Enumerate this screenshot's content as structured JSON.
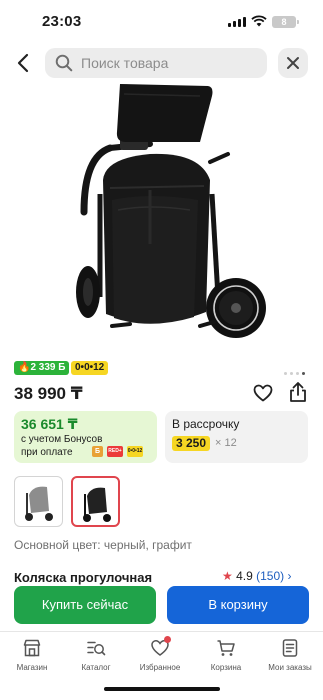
{
  "status_bar": {
    "time": "23:03",
    "battery": "8"
  },
  "search": {
    "placeholder": "Поиск товара"
  },
  "product": {
    "gallery": {
      "current_image": 4,
      "image_count": 4
    },
    "badges": {
      "bonus": "🔥2 339 Б",
      "installment": "0•0•12"
    },
    "price": "38 990 ₸",
    "bonus_card": {
      "price": "36 651 ₸",
      "line1": "с учетом Бонусов",
      "line2": "при оплате",
      "chips": [
        "Б",
        "RED+",
        "0•0•12"
      ]
    },
    "installment_card": {
      "title": "В рассрочку",
      "amount": "3 250",
      "multiplier": "× 12"
    },
    "color": "Основной цвет: черный, графит",
    "name": "Коляска прогулочная",
    "rating": {
      "value": "4.9",
      "reviews": "(150)"
    }
  },
  "actions": {
    "buy_now": "Купить сейчас",
    "add_to_cart": "В корзину"
  },
  "nav": {
    "items": [
      {
        "label": "Магазин",
        "icon": "store-icon"
      },
      {
        "label": "Каталог",
        "icon": "catalog-search-icon"
      },
      {
        "label": "Избранное",
        "icon": "heart-icon"
      },
      {
        "label": "Корзина",
        "icon": "cart-icon"
      },
      {
        "label": "Мои заказы",
        "icon": "orders-icon"
      }
    ]
  },
  "colors": {
    "bonus_green": "#2cb33a",
    "installment_yellow": "#f6d623",
    "buy_green": "#20a34a",
    "cart_blue": "#1565d8",
    "accent_red": "#e0454d"
  }
}
